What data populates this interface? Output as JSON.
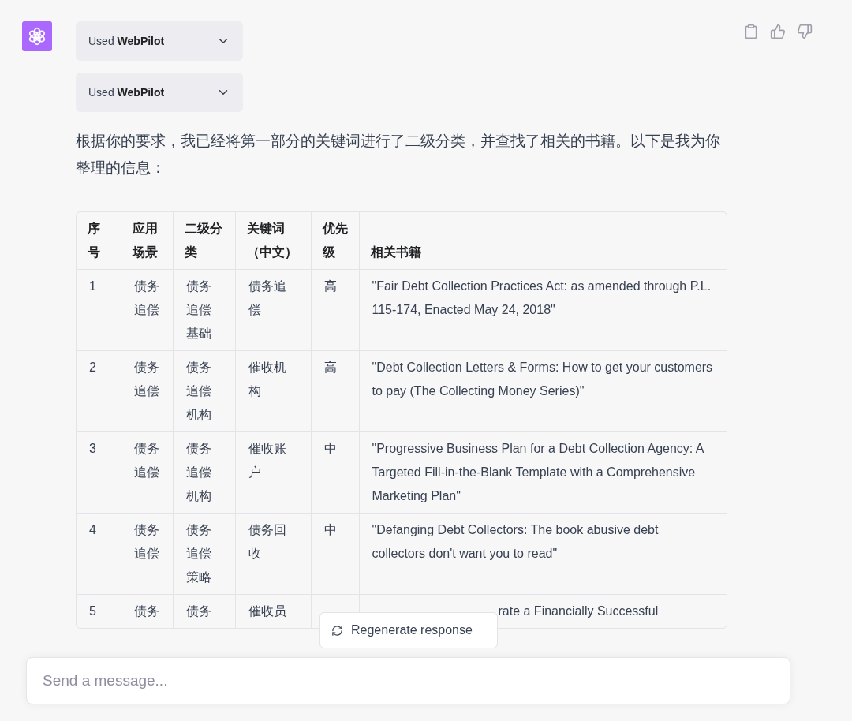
{
  "plugins": [
    {
      "prefix": "Used",
      "name": "WebPilot",
      "expanded": false
    },
    {
      "prefix": "Used",
      "name": "WebPilot",
      "expanded": false
    }
  ],
  "message": "根据你的要求，我已经将第一部分的关键词进行了二级分类，并查找了相关的书籍。以下是我为你整理的信息：",
  "table": {
    "columns": [
      "序号",
      "应用场景",
      "二级分类",
      "关键词（中文）",
      "优先级",
      "相关书籍"
    ],
    "rows": [
      {
        "cells": [
          "1",
          "债务追偿",
          "债务追偿基础",
          "债务追偿",
          "高",
          "\"Fair Debt Collection Practices Act: as amended through P.L. 115-174, Enacted May 24, 2018\""
        ]
      },
      {
        "cells": [
          "2",
          "债务追偿",
          "债务追偿机构",
          "催收机构",
          "高",
          "\"Debt Collection Letters & Forms: How to get your customers to pay (The Collecting Money Series)\""
        ]
      },
      {
        "cells": [
          "3",
          "债务追偿",
          "债务追偿机构",
          "催收账户",
          "中",
          "\"Progressive Business Plan for a Debt Collection Agency: A Targeted Fill-in-the-Blank Template with a Comprehensive Marketing Plan\""
        ]
      },
      {
        "cells": [
          "4",
          "债务追偿",
          "债务追偿策略",
          "债务回收",
          "中",
          "\"Defanging Debt Collectors: The book abusive debt collectors don't want you to read\""
        ]
      },
      {
        "cells": [
          "5",
          "债务",
          "债务",
          "催收员",
          null,
          "rate a Financially Successful"
        ]
      }
    ]
  },
  "regenerate_button": "Regenerate response",
  "composer": {
    "placeholder": "Send a message..."
  }
}
